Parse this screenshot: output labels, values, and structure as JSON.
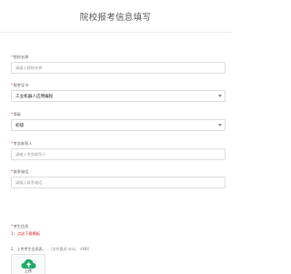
{
  "page": {
    "title": "院校报考信息填写"
  },
  "fields": [
    {
      "label": "院校名称",
      "placeholder": "请输入院校名称",
      "value": ""
    },
    {
      "label": "报考证书",
      "placeholder": "",
      "value": "工业机器人应用编程"
    },
    {
      "label": "等级",
      "placeholder": "",
      "value": "初级"
    },
    {
      "label": "考务联系人",
      "placeholder": "请输入考务联系人",
      "value": ""
    },
    {
      "label": "联系电话",
      "placeholder": "请输入联系电话",
      "value": ""
    }
  ],
  "notes": {
    "label": "考生信息",
    "link": "1、点这下载模板"
  },
  "upload": {
    "hint": "2、上传考生信息表，",
    "tip": "（文件要求:xlsx、 4MB）",
    "button_label": "上传"
  },
  "colors": {
    "required": "#e02020",
    "accent": "#1aad66",
    "link": "#e02020"
  },
  "icons": {
    "upload": "cloud-upload-icon",
    "dropdown": "chevron-down-icon"
  }
}
